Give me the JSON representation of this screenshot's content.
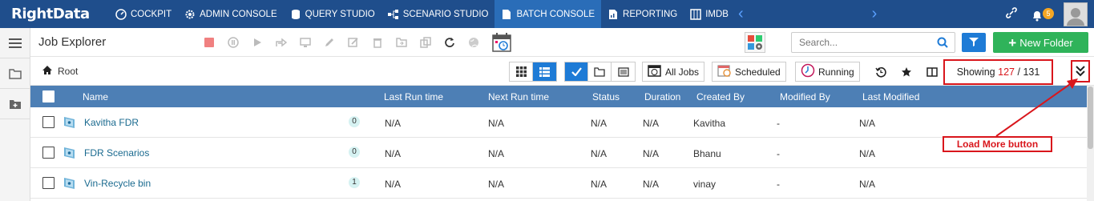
{
  "app": {
    "logo_text": "RightData"
  },
  "topnav": {
    "items": [
      {
        "label": "COCKPIT",
        "icon": "gauge-icon"
      },
      {
        "label": "ADMIN CONSOLE",
        "icon": "gear-icon"
      },
      {
        "label": "QUERY STUDIO",
        "icon": "database-icon"
      },
      {
        "label": "SCENARIO STUDIO",
        "icon": "flow-icon"
      },
      {
        "label": "BATCH CONSOLE",
        "icon": "document-icon",
        "active": true
      },
      {
        "label": "REPORTING",
        "icon": "chart-icon"
      },
      {
        "label": "IMDB",
        "icon": "grid-icon"
      }
    ],
    "notification_count": "5"
  },
  "toolbar": {
    "title": "Job Explorer",
    "search_placeholder": "Search...",
    "new_folder_label": "New Folder"
  },
  "breadcrumb": {
    "root": "Root"
  },
  "filters": {
    "all_jobs": "All Jobs",
    "scheduled": "Scheduled",
    "running": "Running"
  },
  "showing": {
    "prefix": "Showing",
    "shown": "127",
    "separator": "/",
    "total": "131"
  },
  "table": {
    "columns": [
      "Name",
      "Last Run time",
      "Next Run time",
      "Status",
      "Duration",
      "Created By",
      "Modified By",
      "Last Modified"
    ],
    "rows": [
      {
        "name": "Kavitha FDR",
        "count": "0",
        "last_run": "N/A",
        "next_run": "N/A",
        "status": "N/A",
        "duration": "N/A",
        "created_by": "Kavitha",
        "modified_by": "-",
        "last_modified": "N/A"
      },
      {
        "name": "FDR Scenarios",
        "count": "0",
        "last_run": "N/A",
        "next_run": "N/A",
        "status": "N/A",
        "duration": "N/A",
        "created_by": "Bhanu",
        "modified_by": "-",
        "last_modified": "N/A"
      },
      {
        "name": "Vin-Recycle bin",
        "count": "1",
        "last_run": "N/A",
        "next_run": "N/A",
        "status": "N/A",
        "duration": "N/A",
        "created_by": "vinay",
        "modified_by": "-",
        "last_modified": "N/A"
      }
    ]
  },
  "annotation": {
    "label": "Load More button"
  },
  "colors": {
    "nav_bg": "#1f4e8c",
    "nav_active": "#2a6db8",
    "table_header": "#4d7fb5",
    "primary_blue": "#1e7bd6",
    "green": "#2fb35a",
    "annotation_red": "#d9161c",
    "link": "#1a6a8f"
  }
}
